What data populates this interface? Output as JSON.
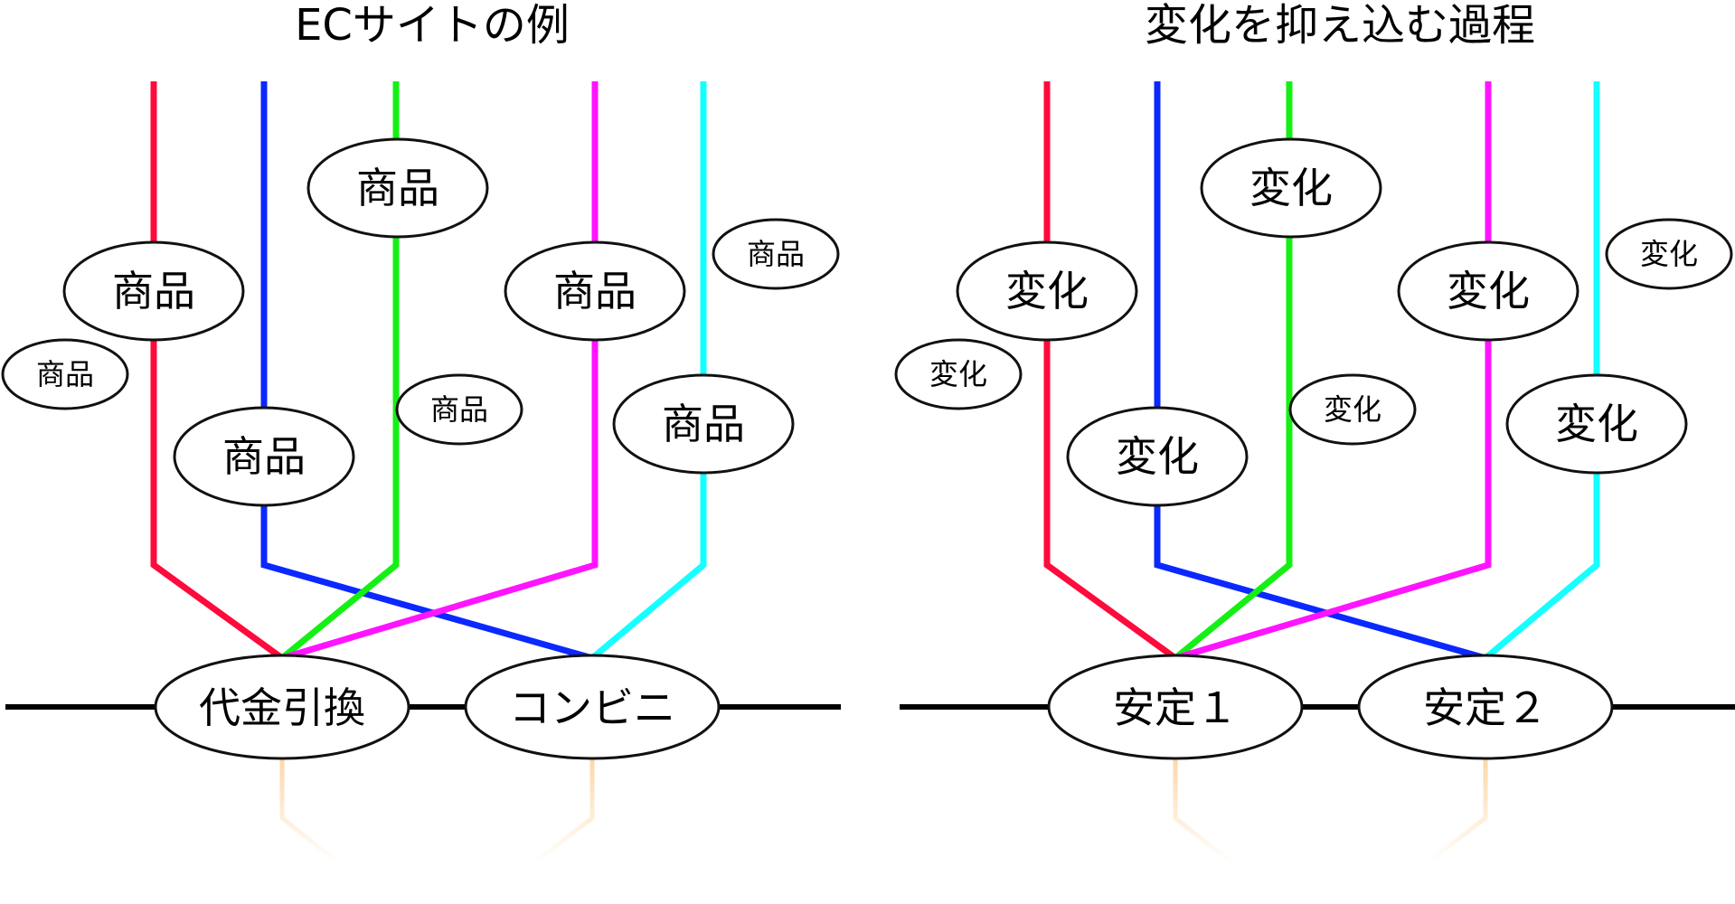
{
  "left": {
    "title": "ECサイトの例",
    "nodes": {
      "item_a": "商品",
      "item_b": "商品",
      "item_c": "商品",
      "item_d": "商品",
      "item_e": "商品",
      "item_f": "商品",
      "item_g": "商品",
      "item_h": "商品",
      "hub_1": "代金引換",
      "hub_2": "コンビニ"
    }
  },
  "right": {
    "title": "変化を抑え込む過程",
    "nodes": {
      "item_a": "変化",
      "item_b": "変化",
      "item_c": "変化",
      "item_d": "変化",
      "item_e": "変化",
      "item_f": "変化",
      "item_g": "変化",
      "item_h": "変化",
      "hub_1": "安定１",
      "hub_2": "安定２"
    }
  },
  "colors": {
    "red": "#ff0a3c",
    "blue": "#0a28ff",
    "green": "#14f014",
    "magenta": "#ff14ff",
    "cyan": "#14ffff",
    "black": "#000000",
    "faded": "#fcdcb4"
  }
}
